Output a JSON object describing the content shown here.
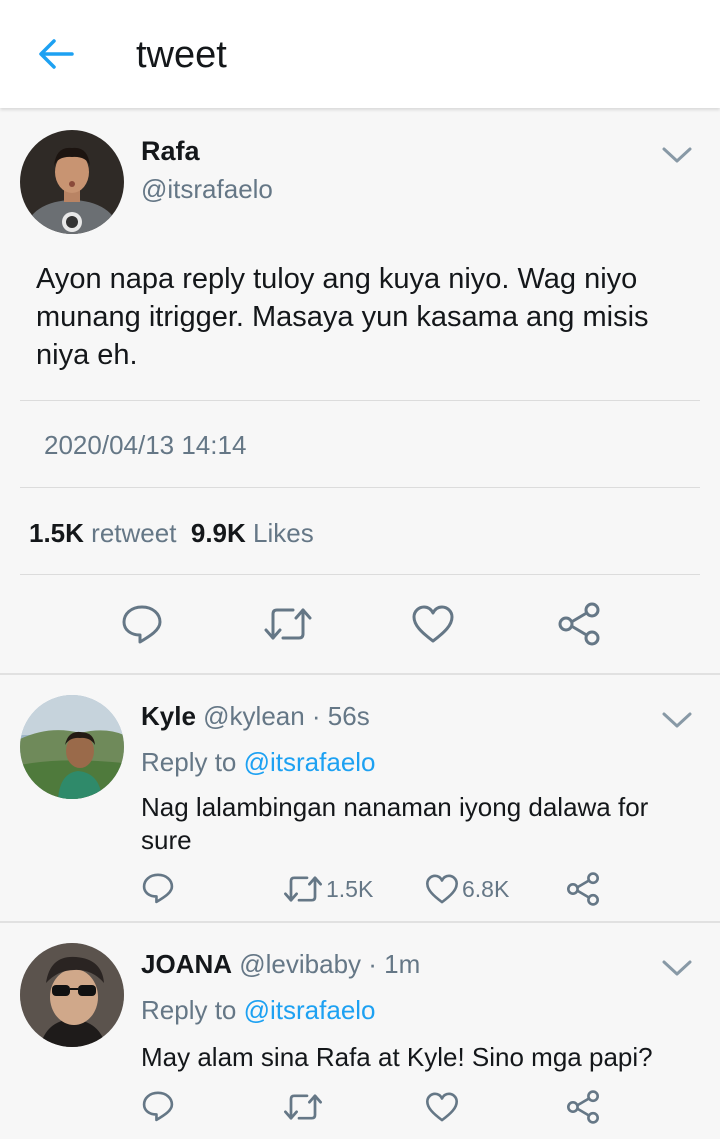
{
  "header": {
    "title": "tweet",
    "back_icon": "arrow-left-icon"
  },
  "main_tweet": {
    "author_name": "Rafa",
    "author_handle": "@itsrafaelo",
    "text": "Ayon napa reply tuloy ang kuya niyo. Wag niyo munang itrigger. Masaya yun kasama ang misis niya eh.",
    "timestamp": "2020/04/13 14:14",
    "retweet_count": "1.5K",
    "retweet_label": "retweet",
    "likes_count": "9.9K",
    "likes_label": "Likes"
  },
  "replies": [
    {
      "name": "Kyle",
      "handle_time": "@kylean · 56s",
      "reply_to_label": "Reply to",
      "reply_to_handle": "@itsrafaelo",
      "text": "Nag lalambingan nanaman iyong dalawa for sure",
      "retweets": "1.5K",
      "likes": "6.8K"
    },
    {
      "name": "JOANA",
      "handle_time": "@levibaby · 1m",
      "reply_to_label": "Reply to",
      "reply_to_handle": "@itsrafaelo",
      "text": "May alam sina Rafa at Kyle! Sino mga papi?",
      "retweets": "",
      "likes": ""
    }
  ],
  "colors": {
    "accent": "#1da1f2",
    "icon": "#657786",
    "text": "#14171a",
    "background": "#f7f7f7"
  }
}
